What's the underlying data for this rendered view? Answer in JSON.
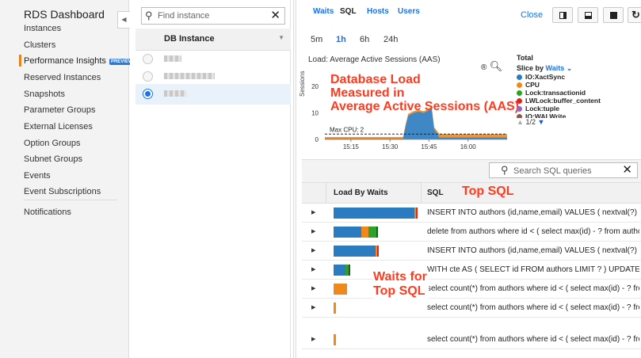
{
  "sidebar": {
    "title": "RDS Dashboard",
    "collapse_glyph": "◀",
    "items": [
      {
        "label": "Instances"
      },
      {
        "label": "Clusters"
      },
      {
        "label": "Performance Insights",
        "badge": "PREVIEW",
        "active": true
      },
      {
        "label": "Reserved Instances"
      },
      {
        "label": "Snapshots"
      },
      {
        "label": "Parameter Groups"
      },
      {
        "label": "External Licenses"
      },
      {
        "label": "Option Groups"
      },
      {
        "label": "Subnet Groups"
      },
      {
        "label": "Events"
      },
      {
        "label": "Event Subscriptions"
      },
      {
        "label": "Notifications"
      }
    ]
  },
  "instances": {
    "search_placeholder": "Find instance",
    "column_header": "DB Instance",
    "rows": [
      {
        "selected": false
      },
      {
        "selected": false
      },
      {
        "selected": true
      }
    ]
  },
  "toolbar": {
    "close_label": "Close",
    "icons": [
      "layout-right-icon",
      "layout-bottom-icon",
      "layout-full-icon",
      "refresh-icon"
    ]
  },
  "time_range": {
    "options": [
      "5m",
      "1h",
      "6h",
      "24h"
    ],
    "selected": "1h"
  },
  "load_chart": {
    "title": "Load: Average Active Sessions (AAS)",
    "zoom_glyphs": "® 🔍",
    "ylabel": "Sessions",
    "max_cpu_label": "Max CPU: 2",
    "annotation": "Database Load\nMeasured in\nAverage Active Sessions (AAS)"
  },
  "chart_data": {
    "type": "area",
    "title": "Load: Average Active Sessions (AAS)",
    "ylabel": "Sessions",
    "xlabel": "",
    "x_ticks": [
      "15:15",
      "15:30",
      "15:45",
      "16:00"
    ],
    "y_ticks": [
      0,
      10,
      20
    ],
    "ylim": [
      0,
      25
    ],
    "max_cpu": 2,
    "x": [
      0,
      5,
      10,
      15,
      20,
      25,
      28,
      30,
      31,
      32,
      34,
      36,
      38,
      40,
      41,
      42,
      44,
      46,
      50,
      55,
      60,
      65,
      70
    ],
    "series": [
      {
        "name": "IO:XactSync",
        "color": "#2a7bbf",
        "values": [
          0.3,
          0.3,
          0.3,
          0.3,
          0.3,
          0.3,
          0.3,
          0.3,
          5,
          9,
          10,
          10.5,
          10,
          11,
          12,
          4,
          0.8,
          0.8,
          0.8,
          0.8,
          0.8,
          0.8,
          0.8
        ]
      },
      {
        "name": "CPU",
        "color": "#f0891c",
        "values": [
          0.6,
          0.6,
          0.6,
          0.6,
          0.6,
          0.6,
          0.6,
          0.6,
          0.6,
          0.6,
          0.6,
          0.6,
          0.6,
          0.6,
          0.6,
          0.6,
          1.2,
          1.2,
          1.2,
          1.2,
          1.2,
          1.2,
          1.2
        ]
      }
    ],
    "legend_position": "right"
  },
  "legend": {
    "total_label": "Total",
    "slice_prefix": "Slice by",
    "slice_value": "Waits",
    "slice_caret": "⌄",
    "items": [
      {
        "label": "IO:XactSync",
        "color": "#2a7bbf"
      },
      {
        "label": "CPU",
        "color": "#f0891c"
      },
      {
        "label": "Lock:transactionid",
        "color": "#2ea02c"
      },
      {
        "label": "LWLock:buffer_content",
        "color": "#d62728"
      },
      {
        "label": "Lock:tuple",
        "color": "#9467bd"
      },
      {
        "label": "IO:WALWrite",
        "color": "#8c564b"
      }
    ],
    "page_label": "1/2"
  },
  "sql_tabs": {
    "tabs": [
      "Waits",
      "SQL",
      "Hosts",
      "Users"
    ],
    "active": "SQL",
    "search_placeholder": "Search SQL queries"
  },
  "sql_table": {
    "col_load": "Load By Waits",
    "col_sql": "SQL",
    "annotation_top_sql": "Top SQL",
    "annotation_waits": "Waits for\nTop SQL",
    "rows": [
      {
        "sql": "INSERT INTO authors (id,name,email) VALUES ( nextval(?) ,?,?)",
        "segments": [
          {
            "color": "#2a7bbf",
            "value": 0.93
          },
          {
            "color": "#f0891c",
            "value": 0.01
          },
          {
            "color": "#d62728",
            "value": 0.01
          }
        ]
      },
      {
        "sql": "delete from authors where id < ( select max(id) - ? from authors...",
        "segments": [
          {
            "color": "#2a7bbf",
            "value": 0.32
          },
          {
            "color": "#f0891c",
            "value": 0.08
          },
          {
            "color": "#2ea02c",
            "value": 0.09
          },
          {
            "color": "#1a5e20",
            "value": 0.02
          }
        ]
      },
      {
        "sql": "INSERT INTO authors (id,name,email) VALUES ( nextval(?) ,?,?)...",
        "segments": [
          {
            "color": "#2a7bbf",
            "value": 0.48
          },
          {
            "color": "#f0891c",
            "value": 0.02
          },
          {
            "color": "#d62728",
            "value": 0.01
          }
        ]
      },
      {
        "sql": "WITH cte AS ( SELECT id FROM authors LIMIT ? ) UPDATE aut...",
        "segments": [
          {
            "color": "#2a7bbf",
            "value": 0.14
          },
          {
            "color": "#2ea02c",
            "value": 0.04
          },
          {
            "color": "#1a5e20",
            "value": 0.02
          }
        ]
      },
      {
        "sql": "select count(*) from authors where id < ( select max(id) - ? from...",
        "segments": [
          {
            "color": "#f0891c",
            "value": 0.15
          }
        ]
      },
      {
        "sql": "select count(*) from authors where id < ( select max(id) - ? from...",
        "segments": [
          {
            "color": "#f0891c",
            "value": 0.03
          }
        ]
      },
      {
        "sql": "select count(*) from authors where id < ( select max(id) - ? from...",
        "segments": [
          {
            "color": "#f0891c",
            "value": 0.03
          }
        ]
      }
    ]
  }
}
